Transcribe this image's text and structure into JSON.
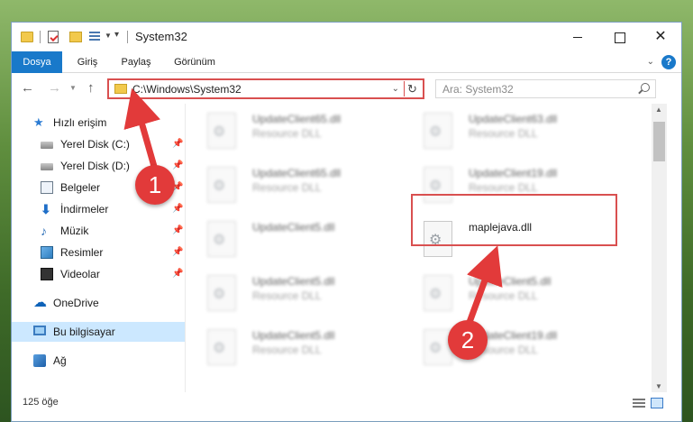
{
  "titlebar": {
    "title": "System32",
    "minimize_label": "",
    "maximize_label": "",
    "close_label": "✕"
  },
  "ribbon": {
    "tabs": [
      "Dosya",
      "Giriş",
      "Paylaş",
      "Görünüm"
    ],
    "help_label": "?"
  },
  "address": {
    "path": "C:\\Windows\\System32",
    "refresh_icon": "↻"
  },
  "search": {
    "placeholder": "Ara: System32"
  },
  "sidebar": {
    "quick_access": "Hızlı erişim",
    "items": [
      {
        "label": "Yerel Disk (C:)",
        "icon": "drive-icon",
        "pinned": true
      },
      {
        "label": "Yerel Disk (D:)",
        "icon": "drive-icon",
        "pinned": true
      },
      {
        "label": "Belgeler",
        "icon": "documents-icon",
        "pinned": true
      },
      {
        "label": "İndirmeler",
        "icon": "downloads-icon",
        "pinned": true
      },
      {
        "label": "Müzik",
        "icon": "music-icon",
        "pinned": true
      },
      {
        "label": "Resimler",
        "icon": "pictures-icon",
        "pinned": true
      },
      {
        "label": "Videolar",
        "icon": "videos-icon",
        "pinned": true
      }
    ],
    "onedrive": "OneDrive",
    "this_pc": "Bu bilgisayar",
    "network": "Ağ"
  },
  "files": [
    {
      "name": "UpdateClient65.dll",
      "type": "Resource DLL"
    },
    {
      "name": "UpdateClient63.dll",
      "type": "Resource DLL"
    },
    {
      "name": "UpdateClient65.dll",
      "type": "Resource DLL"
    },
    {
      "name": "UpdateClient19.dll",
      "type": "Resource DLL"
    },
    {
      "name": "UpdateClient5.dll",
      "type": ""
    },
    {
      "name": "maplejava.dll",
      "type": ""
    },
    {
      "name": "UpdateClient5.dll",
      "type": "Resource DLL"
    },
    {
      "name": "UpdateClient5.dll",
      "type": "Resource DLL"
    },
    {
      "name": "UpdateClient5.dll",
      "type": "Resource DLL"
    },
    {
      "name": "UpdateClient19.dll",
      "type": "Resource DLL"
    }
  ],
  "status": {
    "item_count": "125 öğe"
  },
  "annotations": {
    "step1": "1",
    "step2": "2",
    "color": "#e23a3a"
  }
}
